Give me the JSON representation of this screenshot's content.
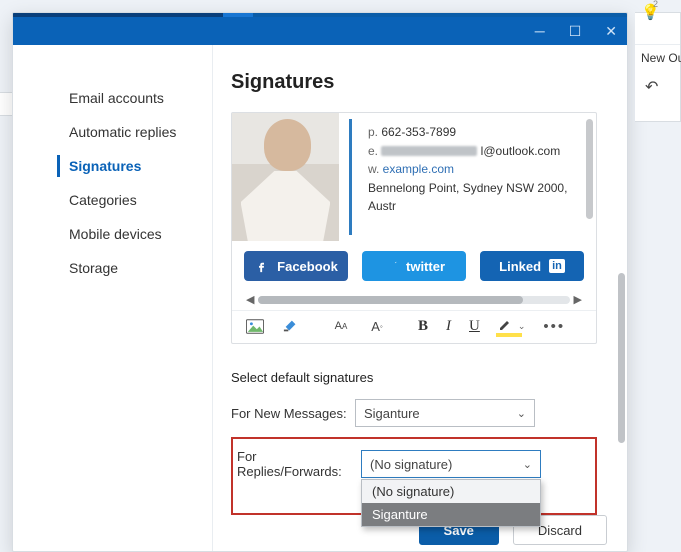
{
  "window": {
    "min": "─",
    "max": "☐",
    "close": "✕"
  },
  "sidebar": {
    "items": [
      {
        "label": "Email accounts"
      },
      {
        "label": "Automatic replies"
      },
      {
        "label": "Signatures"
      },
      {
        "label": "Categories"
      },
      {
        "label": "Mobile devices"
      },
      {
        "label": "Storage"
      }
    ],
    "active_index": 2
  },
  "page": {
    "title": "Signatures",
    "section_label": "Select default signatures",
    "new_messages_label": "For New Messages:",
    "replies_label": "For Replies/Forwards:",
    "save": "Save",
    "discard": "Discard"
  },
  "signature_preview": {
    "phone_label": "p.",
    "phone": "662-353-7899",
    "email_label": "e.",
    "email_suffix": "l@outlook.com",
    "web_label": "w.",
    "web": "example.com",
    "address": "Bennelong Point, Sydney NSW 2000, Austr"
  },
  "socials": {
    "facebook": "Facebook",
    "twitter": "twitter",
    "linkedin_text": "Linked",
    "linkedin_badge": "in"
  },
  "toolbar": {
    "bold": "B",
    "italic": "I",
    "underline": "U"
  },
  "selects": {
    "new_messages_value": "Siganture",
    "replies_value": "(No signature)",
    "replies_options": [
      "(No signature)",
      "Siganture"
    ],
    "replies_selected_index": 1
  },
  "right_panel": {
    "badge": "2",
    "title": "New Out",
    "undo": "↶"
  }
}
